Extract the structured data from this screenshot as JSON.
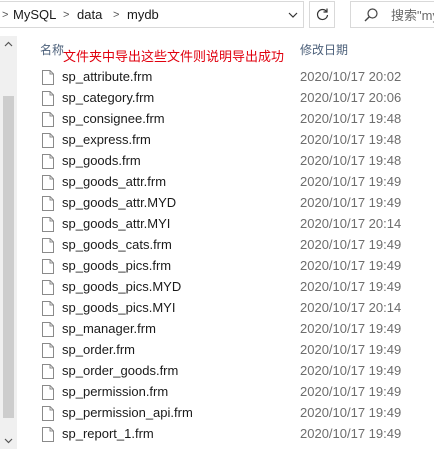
{
  "address": {
    "crumbs": [
      "MySQL",
      "data",
      "mydb"
    ],
    "separator": ">"
  },
  "search": {
    "placeholder": "搜索\"my"
  },
  "header": {
    "name_col": "名称",
    "date_col": "修改日期"
  },
  "annotation": {
    "text": "文件夹中导出这些文件则说明导出成功",
    "color": "#e0000e"
  },
  "files": [
    {
      "name": "sp_attribute.frm",
      "date": "2020/10/17 20:02"
    },
    {
      "name": "sp_category.frm",
      "date": "2020/10/17 20:06"
    },
    {
      "name": "sp_consignee.frm",
      "date": "2020/10/17 19:48"
    },
    {
      "name": "sp_express.frm",
      "date": "2020/10/17 19:48"
    },
    {
      "name": "sp_goods.frm",
      "date": "2020/10/17 19:48"
    },
    {
      "name": "sp_goods_attr.frm",
      "date": "2020/10/17 19:49"
    },
    {
      "name": "sp_goods_attr.MYD",
      "date": "2020/10/17 19:49"
    },
    {
      "name": "sp_goods_attr.MYI",
      "date": "2020/10/17 20:14"
    },
    {
      "name": "sp_goods_cats.frm",
      "date": "2020/10/17 19:49"
    },
    {
      "name": "sp_goods_pics.frm",
      "date": "2020/10/17 19:49"
    },
    {
      "name": "sp_goods_pics.MYD",
      "date": "2020/10/17 19:49"
    },
    {
      "name": "sp_goods_pics.MYI",
      "date": "2020/10/17 20:14"
    },
    {
      "name": "sp_manager.frm",
      "date": "2020/10/17 19:49"
    },
    {
      "name": "sp_order.frm",
      "date": "2020/10/17 19:49"
    },
    {
      "name": "sp_order_goods.frm",
      "date": "2020/10/17 19:49"
    },
    {
      "name": "sp_permission.frm",
      "date": "2020/10/17 19:49"
    },
    {
      "name": "sp_permission_api.frm",
      "date": "2020/10/17 19:49"
    },
    {
      "name": "sp_report_1.frm",
      "date": "2020/10/17 19:49"
    }
  ],
  "icons": {
    "address_dropdown": "chevron-down-icon",
    "refresh": "refresh-icon",
    "search": "search-icon",
    "file": "file-icon",
    "scroll_up": "scroll-up-arrow-icon",
    "scroll_down": "scroll-down-arrow-icon"
  }
}
